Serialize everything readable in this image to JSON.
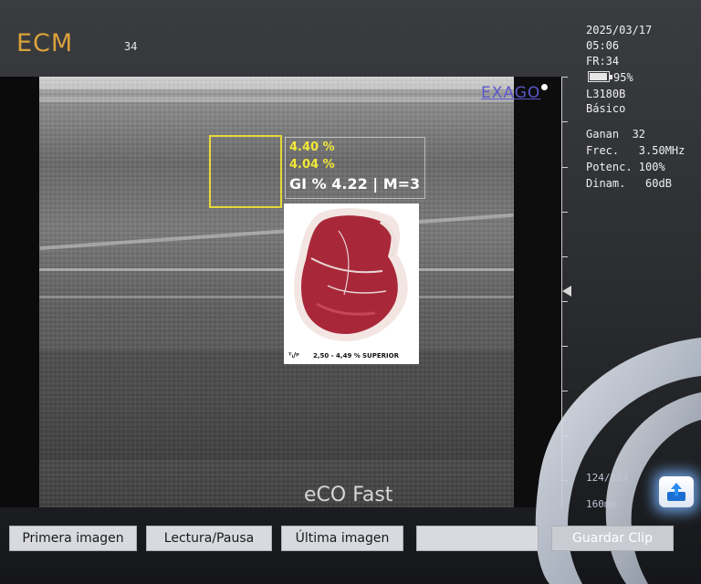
{
  "header": {
    "brand": "ECM",
    "frame_number": "34"
  },
  "status": {
    "date": "2025/03/17",
    "time": "05:06",
    "frame_rate": "FR:34",
    "battery_percent": "95%",
    "battery_level": 0.95,
    "probe": "L3180B",
    "preset": "Básico"
  },
  "params": {
    "gain": "Ganan  32",
    "freq": "Frec.   3.50MHz",
    "power": "Potenc. 100%",
    "dynamic": "Dinam.   60dB"
  },
  "image": {
    "overlay_logo": "EXAGO",
    "mode_label": "eCO Fast",
    "frame_counter": "124/124",
    "depth": "160mm"
  },
  "analysis": {
    "value_1": "4.40 %",
    "value_2": "4.04 %",
    "gi_result": "GI % 4.22 | M=3",
    "card_mark": "ᵀᵢ/ᵖ",
    "card_range": "2,50 - 4,49 %",
    "card_grade": "SUPERIOR"
  },
  "toolbar": {
    "first": "Primera imagen",
    "play": "Lectura/Pausa",
    "last": "Última imagen",
    "blank": "",
    "save": "Guardar Clip"
  },
  "colors": {
    "brand": "#d9a23b",
    "roi": "#e6d83a",
    "accent_blue": "#4a90e2"
  }
}
